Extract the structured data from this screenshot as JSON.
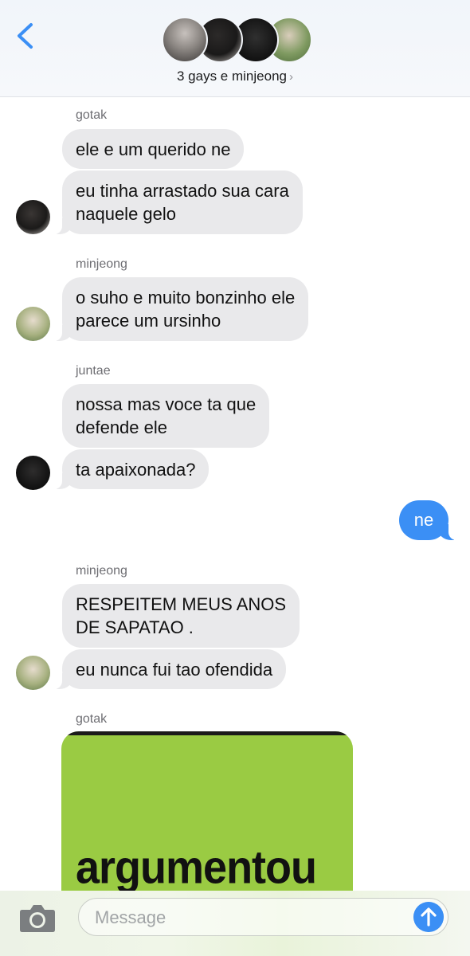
{
  "header": {
    "back_icon": "chevron-left-icon",
    "group_name": "3 gays e minjeong",
    "chevron": "›",
    "accent_color": "#3b8ff5"
  },
  "messages": {
    "g1_sender": "gotak",
    "g1_m1": "ele e um querido ne",
    "g1_m2_l1": "eu tinha arrastado sua cara",
    "g1_m2_l2": "naquele gelo",
    "g2_sender": "minjeong",
    "g2_m1_l1": "o suho e muito bonzinho ele",
    "g2_m1_l2": "parece um ursinho",
    "g3_sender": "juntae",
    "g3_m1_l1": "nossa mas voce ta que",
    "g3_m1_l2": "defende ele",
    "g3_m2": "ta apaixonada?",
    "outgoing": "ne",
    "g4_sender": "minjeong",
    "g4_m1_l1": "RESPEITEM MEUS ANOS",
    "g4_m1_l2": "DE SAPATAO .",
    "g4_m2": "eu nunca fui tao ofendida",
    "g5_sender": "gotak",
    "g5_image_text": "argumentou"
  },
  "input": {
    "placeholder": "Message",
    "camera_icon": "camera-icon",
    "send_icon": "arrow-up-icon"
  }
}
